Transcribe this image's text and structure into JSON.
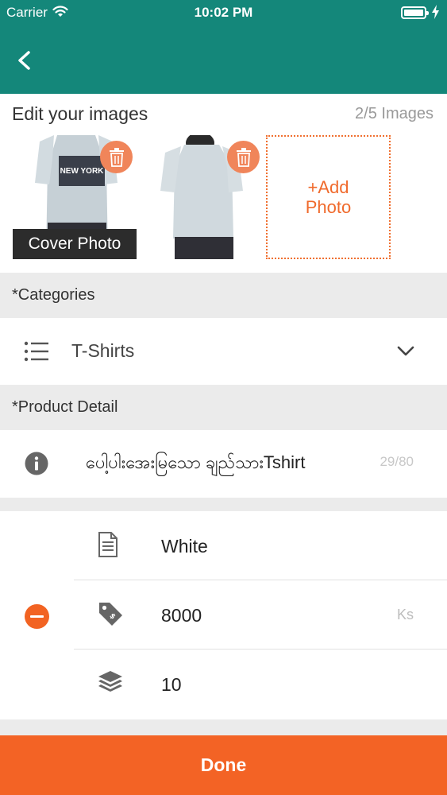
{
  "status_bar": {
    "carrier": "Carrier",
    "time": "10:02 PM"
  },
  "nav": {
    "back_icon": "chevron-left-icon"
  },
  "images": {
    "title": "Edit your images",
    "count": "2/5 Images",
    "cover_label": "Cover Photo",
    "thumb1_print": "NEW YORK",
    "add_photo_line1": "+Add",
    "add_photo_line2": "Photo"
  },
  "categories": {
    "header": "*Categories",
    "selected": "T-Shirts"
  },
  "product_detail": {
    "header": "*Product Detail",
    "name": "ပေါ့ပါးအေးမြသော ချည်သားTshirt",
    "name_count": "29/80"
  },
  "variant": {
    "color": "White",
    "price": "8000",
    "price_unit": "Ks",
    "quantity": "10"
  },
  "footer": {
    "done_label": "Done"
  },
  "colors": {
    "header_green": "#14877a",
    "accent_orange": "#f36325",
    "trash_orange": "#f0855a",
    "section_gray": "#ebebeb"
  }
}
